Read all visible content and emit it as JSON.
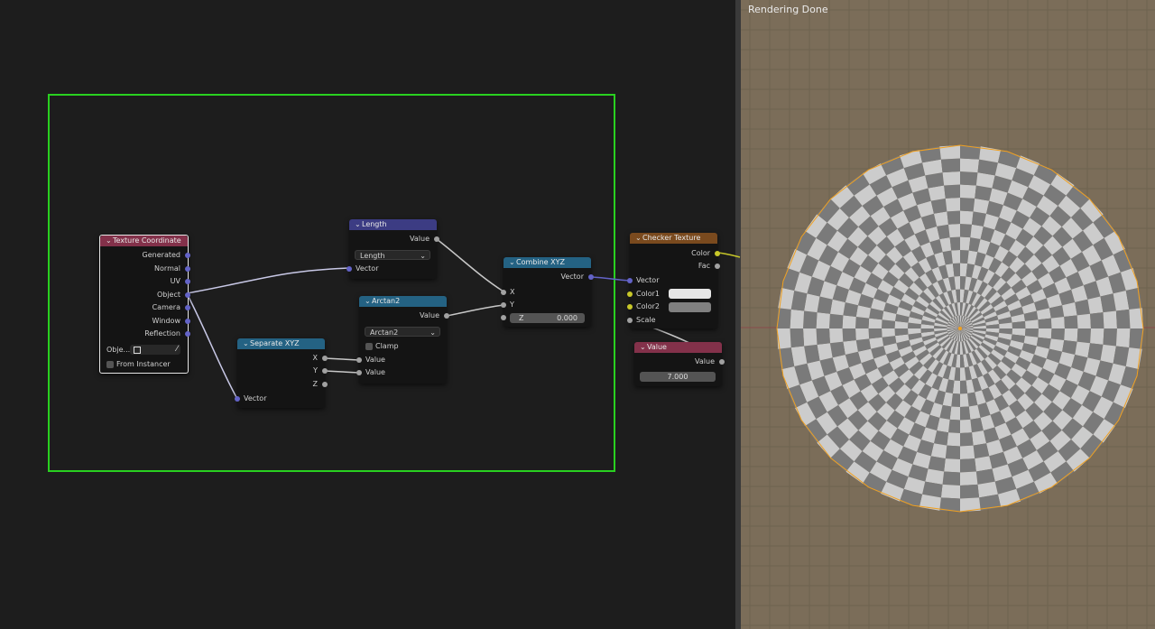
{
  "viewport": {
    "status": "Rendering Done"
  },
  "nodes": {
    "texcoord": {
      "title": "Texture Coordinate",
      "outputs": [
        "Generated",
        "Normal",
        "UV",
        "Object",
        "Camera",
        "Window",
        "Reflection"
      ],
      "object_label": "Obje...",
      "from_instancer": "From Instancer"
    },
    "length": {
      "title": "Length",
      "output": "Value",
      "mode": "Length",
      "input": "Vector"
    },
    "arctan2": {
      "title": "Arctan2",
      "output": "Value",
      "mode": "Arctan2",
      "clamp": "Clamp",
      "input1": "Value",
      "input2": "Value"
    },
    "separate": {
      "title": "Separate XYZ",
      "out_x": "X",
      "out_y": "Y",
      "out_z": "Z",
      "input": "Vector"
    },
    "combine": {
      "title": "Combine XYZ",
      "output": "Vector",
      "in_x": "X",
      "in_y": "Y",
      "in_z_label": "Z",
      "in_z_value": "0.000"
    },
    "checker": {
      "title": "Checker Texture",
      "out_color": "Color",
      "out_fac": "Fac",
      "in_vector": "Vector",
      "in_color1": "Color1",
      "in_color2": "Color2",
      "in_scale": "Scale"
    },
    "value": {
      "title": "Value",
      "output": "Value",
      "number": "7.000"
    }
  },
  "colors": {
    "header_input": "#83314a",
    "header_converter": "#246283",
    "header_vector": "#3c3c83",
    "header_texture": "#7a4a1e",
    "socket_vector": "#6363c7",
    "socket_value": "#a1a1a1",
    "socket_color": "#c7c729",
    "frame": "#29d020",
    "color1_swatch": "#e6e6e6",
    "color2_swatch": "#808080",
    "checker_light": "#cccccc",
    "checker_dark": "#7a7a7a"
  }
}
